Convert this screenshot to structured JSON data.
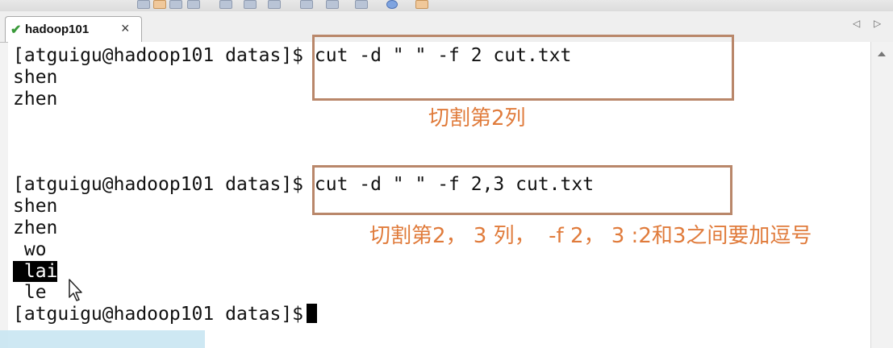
{
  "tab": {
    "title": "hadoop101",
    "close": "×",
    "status_icon": "check-icon"
  },
  "nav": {
    "prev": "◁",
    "next": "▷"
  },
  "terminal": {
    "lines": [
      "[atguigu@hadoop101 datas]$ cut -d \" \" -f 2 cut.txt",
      "shen",
      "zhen",
      "",
      "",
      "[atguigu@hadoop101 datas]$ cut -d \" \" -f 2,3 cut.txt",
      "shen",
      "zhen",
      " wo",
      "lai",
      " le",
      "[atguigu@hadoop101 datas]$"
    ],
    "selected_line_prefix": " "
  },
  "annotations": {
    "note1": "切割第2列",
    "note2": "切割第2， 3 列，  -f 2， 3 :2和3之间要加逗号",
    "color": "#e07b3b",
    "box_color": "#b9876a"
  }
}
